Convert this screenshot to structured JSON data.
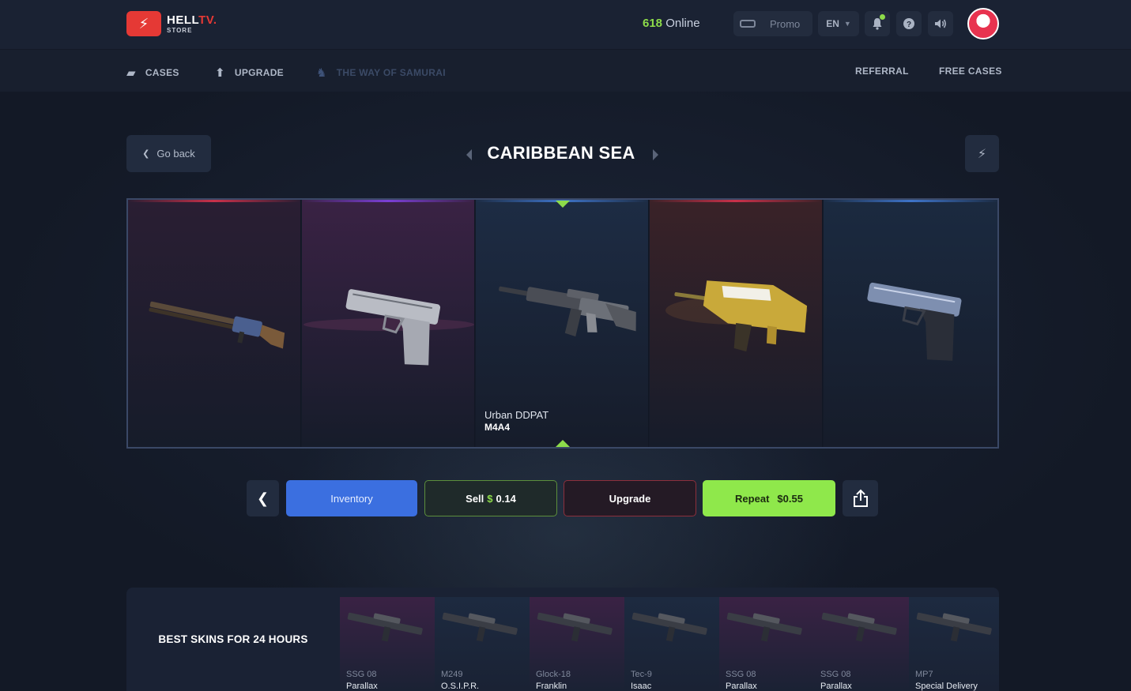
{
  "header": {
    "logo_main": "HELL",
    "logo_tv": "TV.",
    "logo_sub": "STORE",
    "online_count": "618",
    "online_label": "Online",
    "promo_placeholder": "Promo",
    "language": "EN"
  },
  "nav": {
    "cases": "CASES",
    "upgrade": "UPGRADE",
    "samurai": "THE WAY OF SAMURAI",
    "referral": "REFERRAL",
    "free_cases": "FREE CASES"
  },
  "case": {
    "go_back": "Go back",
    "title": "CARIBBEAN SEA"
  },
  "roulette": {
    "slots": [
      {
        "weapon": "",
        "skin": "",
        "rarity_color": "#c9314a",
        "bg": "#2a1e33",
        "icon": "shotgun-icon"
      },
      {
        "weapon": "",
        "skin": "",
        "rarity_color": "#7b3fd6",
        "bg": "#3a2244",
        "icon": "pistol-icon"
      },
      {
        "weapon": "M4A4",
        "skin": "Urban DDPAT",
        "rarity_color": "#3e74c9",
        "bg": "#1d2c44",
        "icon": "rifle-icon"
      },
      {
        "weapon": "",
        "skin": "",
        "rarity_color": "#c9314a",
        "bg": "#3a2228",
        "icon": "famas-icon"
      },
      {
        "weapon": "",
        "skin": "",
        "rarity_color": "#3e74c9",
        "bg": "#1b2a40",
        "icon": "pistol-icon"
      }
    ]
  },
  "actions": {
    "inventory": "Inventory",
    "sell_label": "Sell",
    "sell_currency": "$",
    "sell_price": "0.14",
    "upgrade": "Upgrade",
    "repeat_label": "Repeat",
    "repeat_price": "$0.55"
  },
  "best_skins": {
    "title": "BEST SKINS FOR 24 HOURS",
    "items": [
      {
        "weapon": "SSG 08",
        "skin": "Parallax",
        "bg": "#3a2244"
      },
      {
        "weapon": "M249",
        "skin": "O.S.I.P.R.",
        "bg": "#1d2a40"
      },
      {
        "weapon": "Glock-18",
        "skin": "Franklin",
        "bg": "#3a2244"
      },
      {
        "weapon": "Tec-9",
        "skin": "Isaac",
        "bg": "#1d2a40"
      },
      {
        "weapon": "SSG 08",
        "skin": "Parallax",
        "bg": "#3a2244"
      },
      {
        "weapon": "SSG 08",
        "skin": "Parallax",
        "bg": "#3a2244"
      },
      {
        "weapon": "MP7",
        "skin": "Special Delivery",
        "bg": "#1d2a40"
      }
    ]
  }
}
